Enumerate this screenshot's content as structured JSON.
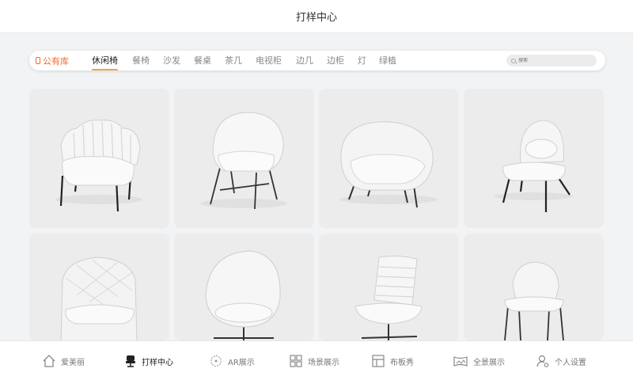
{
  "header": {
    "title": "打样中心"
  },
  "filter": {
    "library_label": "公有库",
    "categories": [
      "休闲椅",
      "餐椅",
      "沙发",
      "餐桌",
      "茶几",
      "电视柜",
      "边几",
      "边柜",
      "灯",
      "绿植"
    ],
    "active_index": 0,
    "search_placeholder": "搜索"
  },
  "products": [
    {
      "icon": "scalloped-armchair-icon"
    },
    {
      "icon": "shell-lounge-chair-icon"
    },
    {
      "icon": "tub-armchair-icon"
    },
    {
      "icon": "pillow-lounge-chair-icon"
    },
    {
      "icon": "quilted-armchair-icon"
    },
    {
      "icon": "egg-chair-icon"
    },
    {
      "icon": "ribbed-office-chair-icon"
    },
    {
      "icon": "dining-chair-icon"
    }
  ],
  "tabbar": {
    "items": [
      {
        "label": "爱美丽",
        "icon": "home-icon"
      },
      {
        "label": "打样中心",
        "icon": "chair-icon"
      },
      {
        "label": "AR展示",
        "icon": "ar-icon"
      },
      {
        "label": "场景展示",
        "icon": "grid-icon"
      },
      {
        "label": "布板秀",
        "icon": "layout-icon"
      },
      {
        "label": "全景展示",
        "icon": "panorama-icon"
      },
      {
        "label": "个人设置",
        "icon": "user-settings-icon"
      }
    ],
    "active_index": 1
  },
  "colors": {
    "accent": "#f26b2b",
    "underline": "#f5a04a"
  }
}
